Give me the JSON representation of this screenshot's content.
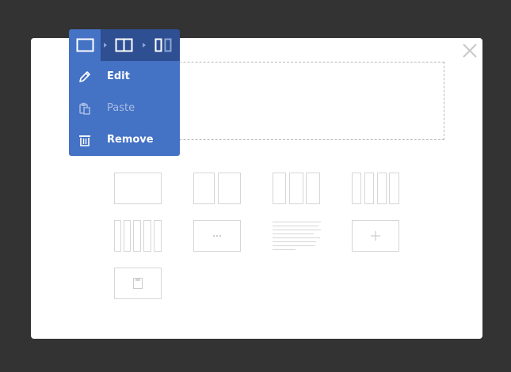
{
  "menu": {
    "items": [
      {
        "label": "Edit",
        "icon": "pencil-icon",
        "disabled": false
      },
      {
        "label": "Paste",
        "icon": "clipboard-icon",
        "disabled": true
      },
      {
        "label": "Remove",
        "icon": "trash-icon",
        "disabled": false
      }
    ]
  },
  "toolbar": {
    "buttons": [
      {
        "icon": "single-column-icon",
        "active": true
      },
      {
        "icon": "two-column-icon",
        "active": false
      },
      {
        "icon": "narrow-column-icon",
        "active": false
      }
    ]
  },
  "layouts": [
    {
      "icon": "layout-1-column-icon"
    },
    {
      "icon": "layout-2-columns-icon"
    },
    {
      "icon": "layout-3-columns-icon"
    },
    {
      "icon": "layout-4-columns-icon"
    },
    {
      "icon": "layout-5-columns-icon"
    },
    {
      "icon": "layout-separator-icon"
    },
    {
      "icon": "layout-text-icon"
    },
    {
      "icon": "layout-add-icon"
    },
    {
      "icon": "layout-box-icon"
    }
  ],
  "colors": {
    "menu_bg": "#4472c4",
    "toolbar_bg": "#2e4f92",
    "backdrop": "#333333",
    "disabled_text": "#a9bde4"
  }
}
